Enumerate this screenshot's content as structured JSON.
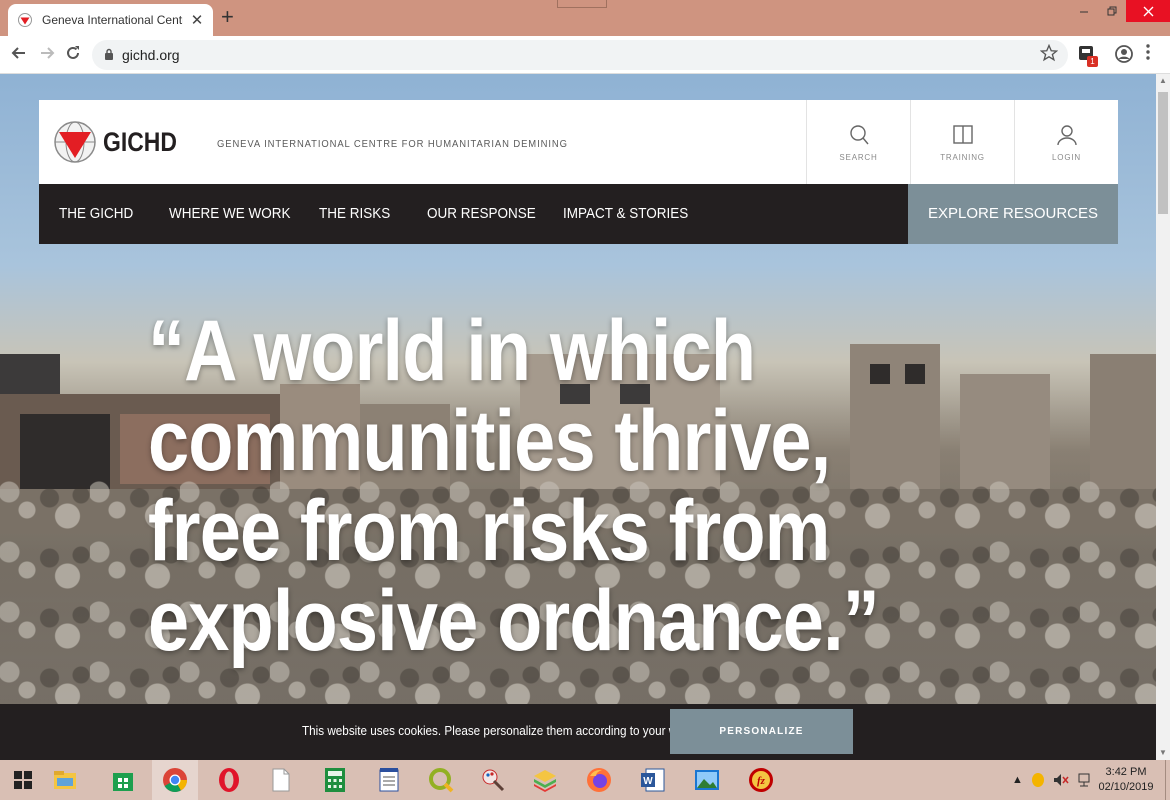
{
  "browser": {
    "tab_title": "Geneva International Centre for H",
    "tab_close": "✕",
    "new_tab": "+",
    "url": "gichd.org",
    "extension_badge": "1"
  },
  "site": {
    "logo_text": "GICHD",
    "tagline": "GENEVA INTERNATIONAL CENTRE FOR HUMANITARIAN DEMINING",
    "utility_nav": [
      {
        "label": "SEARCH",
        "icon": "search-icon"
      },
      {
        "label": "TRAINING",
        "icon": "book-icon"
      },
      {
        "label": "LOGIN",
        "icon": "user-icon"
      }
    ],
    "main_nav": [
      "THE GICHD",
      "WHERE WE WORK",
      "THE RISKS",
      "OUR RESPONSE",
      "IMPACT & STORIES"
    ],
    "explore_label": "EXPLORE RESOURCES",
    "hero_quote": "“A world in which communities thrive, free from risks from explosive ordnance.”",
    "colors": {
      "dark": "#231f20",
      "accent_gray": "#7c8f98",
      "logo_red": "#e31e24"
    }
  },
  "cookie": {
    "message": "This website uses cookies. Please personalize them according to your wishes",
    "button_label": "PERSONALIZE"
  },
  "taskbar": {
    "time": "3:42 PM",
    "date": "02/10/2019",
    "apps": [
      "start-icon",
      "file-explorer-icon",
      "store-icon",
      "chrome-icon",
      "opera-icon",
      "blank-file-icon",
      "calculator-icon",
      "notepad-icon",
      "qgis-icon",
      "paint-icon",
      "bluestacks-icon",
      "firefox-icon",
      "word-icon",
      "photos-icon",
      "filezilla-icon"
    ]
  }
}
